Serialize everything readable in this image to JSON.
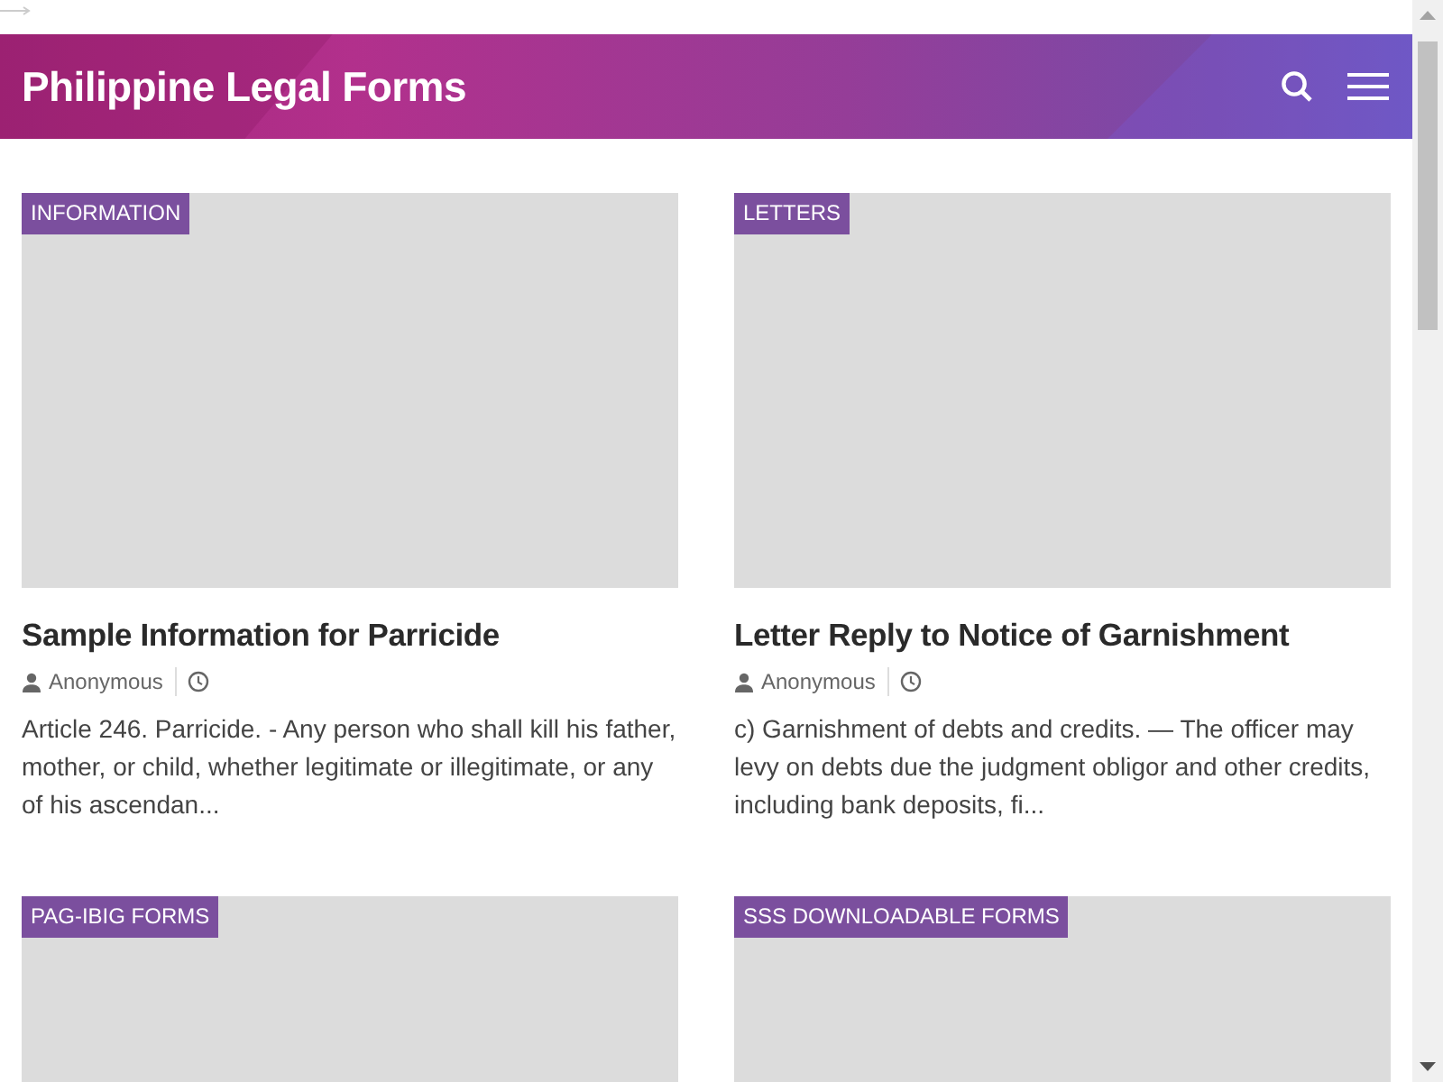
{
  "site_title": "Philippine Legal Forms",
  "posts": [
    {
      "category": "INFORMATION",
      "title": "Sample Information for Parricide",
      "author": "Anonymous",
      "excerpt": "Article 246. Parricide. - Any person who shall kill his father, mother, or child, whether legitimate or illegitimate, or any of his ascendan..."
    },
    {
      "category": "LETTERS",
      "title": "Letter Reply to Notice of Garnishment",
      "author": "Anonymous",
      "excerpt": "c) Garnishment of debts and credits. — The officer may levy on debts due the judgment obligor and other credits, including bank deposits, fi..."
    },
    {
      "category": "PAG-IBIG FORMS"
    },
    {
      "category": "SSS DOWNLOADABLE FORMS"
    }
  ]
}
